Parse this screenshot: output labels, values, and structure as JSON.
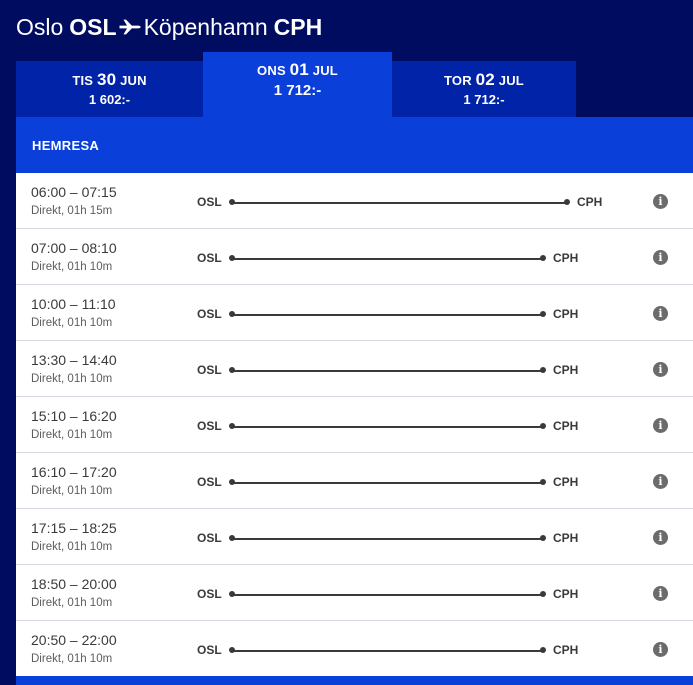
{
  "header": {
    "origin_city": "Oslo",
    "origin_code": "OSL",
    "plane_icon": "plane-icon",
    "destination_city": "Köpenhamn",
    "destination_code": "CPH"
  },
  "date_tabs": [
    {
      "weekday": "TIS",
      "day": "30",
      "month": "JUN",
      "price": "1 602:-",
      "selected": false
    },
    {
      "weekday": "ONS",
      "day": "01",
      "month": "JUL",
      "price": "1 712:-",
      "selected": true
    },
    {
      "weekday": "TOR",
      "day": "02",
      "month": "JUL",
      "price": "1 712:-",
      "selected": false
    }
  ],
  "section": {
    "title": "HEMRESA"
  },
  "flights": [
    {
      "times": "06:00 – 07:15",
      "info": "Direkt, 01h 15m",
      "origin": "OSL",
      "destination": "CPH"
    },
    {
      "times": "07:00 – 08:10",
      "info": "Direkt, 01h 10m",
      "origin": "OSL",
      "destination": "CPH"
    },
    {
      "times": "10:00 – 11:10",
      "info": "Direkt, 01h 10m",
      "origin": "OSL",
      "destination": "CPH"
    },
    {
      "times": "13:30 – 14:40",
      "info": "Direkt, 01h 10m",
      "origin": "OSL",
      "destination": "CPH"
    },
    {
      "times": "15:10 – 16:20",
      "info": "Direkt, 01h 10m",
      "origin": "OSL",
      "destination": "CPH"
    },
    {
      "times": "16:10 – 17:20",
      "info": "Direkt, 01h 10m",
      "origin": "OSL",
      "destination": "CPH"
    },
    {
      "times": "17:15 – 18:25",
      "info": "Direkt, 01h 10m",
      "origin": "OSL",
      "destination": "CPH"
    },
    {
      "times": "18:50 – 20:00",
      "info": "Direkt, 01h 10m",
      "origin": "OSL",
      "destination": "CPH"
    },
    {
      "times": "20:50 – 22:00",
      "info": "Direkt, 01h 10m",
      "origin": "OSL",
      "destination": "CPH"
    }
  ],
  "info_icon": "info-icon",
  "colors": {
    "background": "#000c5f",
    "tab": "#0023a8",
    "accent": "#0a3fd9",
    "text": "#3a3a3a"
  }
}
